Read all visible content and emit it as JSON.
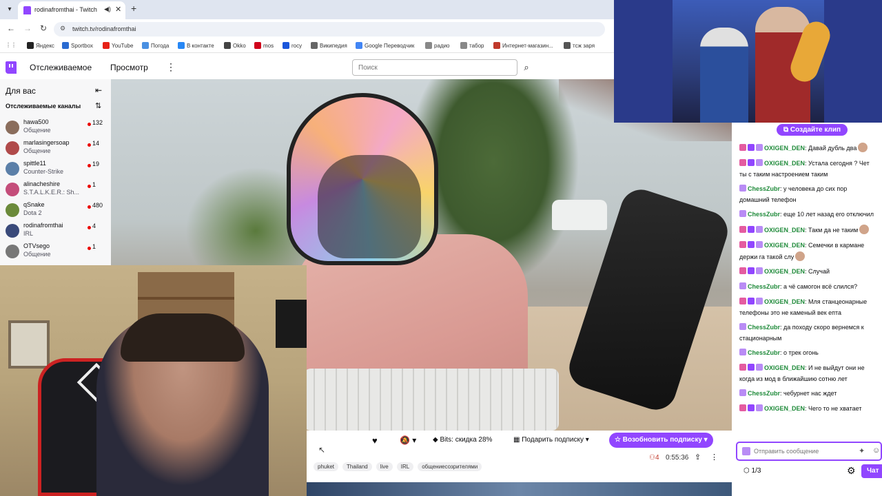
{
  "browser": {
    "tab_title": "rodinafromthai - Twitch",
    "url": "twitch.tv/rodinafromthai",
    "bookmarks": [
      {
        "label": "Яндекс",
        "color": "#222222"
      },
      {
        "label": "Sportbox",
        "color": "#2a6bd1"
      },
      {
        "label": "YouTube",
        "color": "#e62117"
      },
      {
        "label": "Погода",
        "color": "#4a90e2"
      },
      {
        "label": "В контакте",
        "color": "#2787f5"
      },
      {
        "label": "Okko",
        "color": "#444444"
      },
      {
        "label": "mos",
        "color": "#d0021b"
      },
      {
        "label": "rocy",
        "color": "#1a56db"
      },
      {
        "label": "Википедия",
        "color": "#666666"
      },
      {
        "label": "Google Переводчик",
        "color": "#4285f4"
      },
      {
        "label": "радио",
        "color": "#888888"
      },
      {
        "label": "табор",
        "color": "#888888"
      },
      {
        "label": "Интернет-магазин...",
        "color": "#c0392b"
      },
      {
        "label": "тсж заря",
        "color": "#555555"
      }
    ]
  },
  "twitch_nav": {
    "following": "Отслеживаемое",
    "browse": "Просмотр",
    "search_placeholder": "Поиск"
  },
  "sidebar": {
    "header": "Для вас",
    "subheader": "Отслеживаемые каналы",
    "channels": [
      {
        "name": "hawa500",
        "game": "Общение",
        "viewers": "132",
        "color": "#8a6d5c"
      },
      {
        "name": "marlasingersoap",
        "game": "Общение",
        "viewers": "14",
        "color": "#b04a4a"
      },
      {
        "name": "spittle11",
        "game": "Counter-Strike",
        "viewers": "19",
        "color": "#5b7fa8"
      },
      {
        "name": "alinacheshire",
        "game": "S.T.A.L.K.E.R.: Sh...",
        "viewers": "1",
        "color": "#c44d7a"
      },
      {
        "name": "qSnake",
        "game": "Dota 2",
        "viewers": "480",
        "color": "#6b8a3a"
      },
      {
        "name": "rodinafromthai",
        "game": "IRL",
        "viewers": "4",
        "color": "#3a4a7a"
      },
      {
        "name": "OTVsego",
        "game": "Общение",
        "viewers": "1",
        "color": "#777777"
      }
    ]
  },
  "player": {
    "bits_label": "Bits: скидка 28%",
    "gift_label": "Подарить подписку",
    "resub_label": "Возобновить подписку",
    "viewers": "4",
    "uptime": "0:55:36",
    "tags": [
      "phuket",
      "Thailand",
      "live",
      "IRL",
      "общениесозрителями"
    ]
  },
  "chat": {
    "clip_button": "Создайте клип",
    "messages": [
      {
        "user": "OXIGEN_DEN",
        "badges": 3,
        "text": "Давай дубль два",
        "emote": true
      },
      {
        "user": "OXIGEN_DEN",
        "badges": 3,
        "text": "Устала сегодня ? Чет ты с таким настроением таким",
        "emote": false
      },
      {
        "user": "ChessZubr",
        "badges": 1,
        "text": "у человека до сих пор домашний телефон",
        "emote": false
      },
      {
        "user": "ChessZubr",
        "badges": 1,
        "text": "еще 10 лет назад его отключил",
        "emote": false
      },
      {
        "user": "OXIGEN_DEN",
        "badges": 3,
        "text": "Такм да не таким",
        "emote": true
      },
      {
        "user": "OXIGEN_DEN",
        "badges": 3,
        "text": "Семечки в кармане держи га такой слу",
        "emote": true
      },
      {
        "user": "OXIGEN_DEN",
        "badges": 3,
        "text": "Случай",
        "emote": false
      },
      {
        "user": "ChessZubr",
        "badges": 1,
        "text": "а чё самогон всё слился?",
        "emote": false
      },
      {
        "user": "OXIGEN_DEN",
        "badges": 3,
        "text": "Мля станцеонарные телефоны это не каменый век епта",
        "emote": false
      },
      {
        "user": "ChessZubr",
        "badges": 1,
        "text": "да походу скоро вернемся к стационарным",
        "emote": false
      },
      {
        "user": "ChessZubr",
        "badges": 1,
        "text": "о трек огонь",
        "emote": false
      },
      {
        "user": "OXIGEN_DEN",
        "badges": 3,
        "text": "И не выйдут они не когда из мод в ближайшию сотню лет",
        "emote": false
      },
      {
        "user": "ChessZubr",
        "badges": 1,
        "text": "чебурнет нас ждет",
        "emote": false
      },
      {
        "user": "OXIGEN_DEN",
        "badges": 3,
        "text": "Чего то не хватает",
        "emote": false
      }
    ],
    "input_placeholder": "Отправить сообщение",
    "points": "1/3",
    "chat_button": "Чат"
  },
  "colors": {
    "twitch_purple": "#9146ff",
    "live_red": "#eb0400"
  }
}
